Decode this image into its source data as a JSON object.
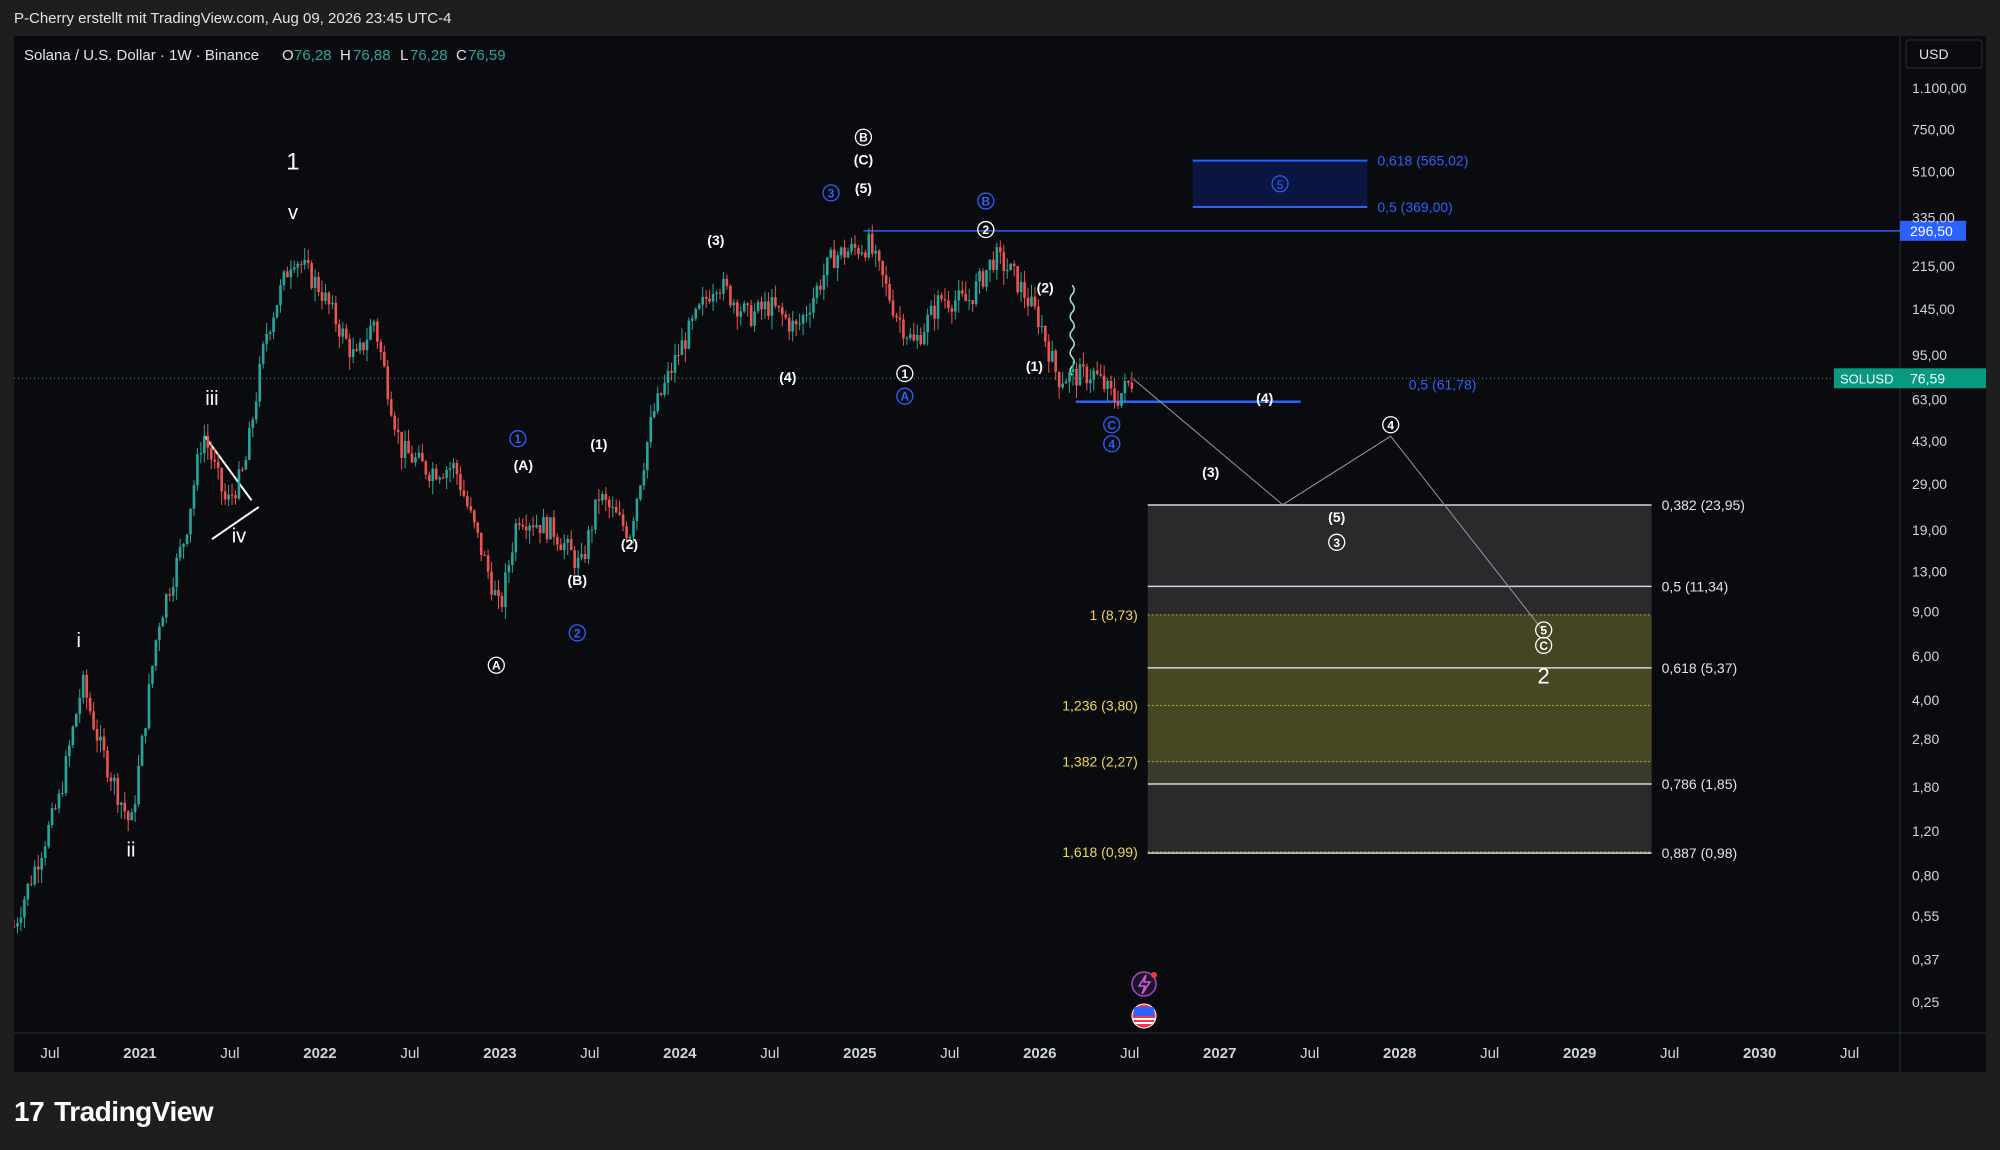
{
  "attribution": "P-Cherry erstellt mit TradingView.com, Aug 09, 2026 23:45 UTC-4",
  "brand": {
    "name": "TradingView",
    "logo_glyph": "17"
  },
  "chart_data": {
    "type": "candlestick",
    "symbol_line": "Solana / U.S. Dollar · 1W · Binance",
    "ohlc": {
      "O_label": "O",
      "O": "76,28",
      "H_label": "H",
      "H": "76,88",
      "L_label": "L",
      "L": "76,28",
      "C_label": "C",
      "C": "76,59"
    },
    "currency": "USD",
    "y_scale": "log",
    "y_ticks": [
      "1.100,00",
      "750,00",
      "510,00",
      "335,00",
      "215,00",
      "145,00",
      "95,00",
      "63,00",
      "43,00",
      "29,00",
      "19,00",
      "13,00",
      "9,00",
      "6,00",
      "4,00",
      "2,80",
      "1,80",
      "1,20",
      "0,80",
      "0,55",
      "0,37",
      "0,25"
    ],
    "y_tick_values": [
      1100,
      750,
      510,
      335,
      215,
      145,
      95,
      63,
      43,
      29,
      19,
      13,
      9,
      6,
      4,
      2.8,
      1.8,
      1.2,
      0.8,
      0.55,
      0.37,
      0.25
    ],
    "x_ticks": [
      {
        "label": "Jul",
        "t": 2020.5,
        "bold": false
      },
      {
        "label": "2021",
        "t": 2021.0,
        "bold": true
      },
      {
        "label": "Jul",
        "t": 2021.5,
        "bold": false
      },
      {
        "label": "2022",
        "t": 2022.0,
        "bold": true
      },
      {
        "label": "Jul",
        "t": 2022.5,
        "bold": false
      },
      {
        "label": "2023",
        "t": 2023.0,
        "bold": true
      },
      {
        "label": "Jul",
        "t": 2023.5,
        "bold": false
      },
      {
        "label": "2024",
        "t": 2024.0,
        "bold": true
      },
      {
        "label": "Jul",
        "t": 2024.5,
        "bold": false
      },
      {
        "label": "2025",
        "t": 2025.0,
        "bold": true
      },
      {
        "label": "Jul",
        "t": 2025.5,
        "bold": false
      },
      {
        "label": "2026",
        "t": 2026.0,
        "bold": true
      },
      {
        "label": "Jul",
        "t": 2026.5,
        "bold": false
      },
      {
        "label": "2027",
        "t": 2027.0,
        "bold": true
      },
      {
        "label": "Jul",
        "t": 2027.5,
        "bold": false
      },
      {
        "label": "2028",
        "t": 2028.0,
        "bold": true
      },
      {
        "label": "Jul",
        "t": 2028.5,
        "bold": false
      },
      {
        "label": "2029",
        "t": 2029.0,
        "bold": true
      },
      {
        "label": "Jul",
        "t": 2029.5,
        "bold": false
      },
      {
        "label": "2030",
        "t": 2030.0,
        "bold": true
      },
      {
        "label": "Jul",
        "t": 2030.5,
        "bold": false
      }
    ],
    "price_path": [
      {
        "t": 2020.3,
        "p": 0.5
      },
      {
        "t": 2020.55,
        "p": 1.6
      },
      {
        "t": 2020.68,
        "p": 4.7
      },
      {
        "t": 2020.78,
        "p": 2.6
      },
      {
        "t": 2020.95,
        "p": 1.25
      },
      {
        "t": 2021.1,
        "p": 8.0
      },
      {
        "t": 2021.25,
        "p": 18
      },
      {
        "t": 2021.35,
        "p": 47
      },
      {
        "t": 2021.48,
        "p": 24
      },
      {
        "t": 2021.58,
        "p": 33
      },
      {
        "t": 2021.7,
        "p": 115
      },
      {
        "t": 2021.85,
        "p": 240
      },
      {
        "t": 2022.0,
        "p": 175
      },
      {
        "t": 2022.2,
        "p": 90
      },
      {
        "t": 2022.3,
        "p": 130
      },
      {
        "t": 2022.45,
        "p": 40
      },
      {
        "t": 2022.6,
        "p": 33
      },
      {
        "t": 2022.75,
        "p": 34
      },
      {
        "t": 2022.95,
        "p": 12
      },
      {
        "t": 2023.0,
        "p": 9
      },
      {
        "t": 2023.1,
        "p": 22
      },
      {
        "t": 2023.3,
        "p": 19
      },
      {
        "t": 2023.45,
        "p": 13.5
      },
      {
        "t": 2023.55,
        "p": 26
      },
      {
        "t": 2023.72,
        "p": 18.5
      },
      {
        "t": 2023.85,
        "p": 55
      },
      {
        "t": 2024.0,
        "p": 100
      },
      {
        "t": 2024.2,
        "p": 190
      },
      {
        "t": 2024.38,
        "p": 135
      },
      {
        "t": 2024.5,
        "p": 150
      },
      {
        "t": 2024.65,
        "p": 120
      },
      {
        "t": 2024.85,
        "p": 235
      },
      {
        "t": 2025.05,
        "p": 262
      },
      {
        "t": 2025.2,
        "p": 140
      },
      {
        "t": 2025.3,
        "p": 105
      },
      {
        "t": 2025.45,
        "p": 160
      },
      {
        "t": 2025.6,
        "p": 155
      },
      {
        "t": 2025.75,
        "p": 235
      },
      {
        "t": 2025.85,
        "p": 200
      },
      {
        "t": 2026.0,
        "p": 130
      },
      {
        "t": 2026.1,
        "p": 77
      },
      {
        "t": 2026.3,
        "p": 80
      },
      {
        "t": 2026.42,
        "p": 63
      },
      {
        "t": 2026.52,
        "p": 76
      }
    ],
    "last_price": {
      "label": "76,59",
      "value": 76.59,
      "symbol": "SOLUSD"
    },
    "resistance": {
      "label": "296,50",
      "value": 296.5,
      "t_start": 2025.02,
      "t_end": 2031.0
    },
    "support": {
      "value": 61.78,
      "t_start": 2026.2,
      "t_end": 2027.45
    },
    "support_label": "0,5 (61,78)",
    "target_box": {
      "t_start": 2026.85,
      "t_end": 2027.82,
      "top": 565.02,
      "bottom": 369.0,
      "wave": "5",
      "labels": [
        {
          "text": "0,618 (565,02)",
          "value": 565.02
        },
        {
          "text": "0,5 (369,00)",
          "value": 369.0
        }
      ]
    },
    "retracement": {
      "t_start": 2026.6,
      "t_end": 2029.4,
      "levels": [
        {
          "text": "0,382 (23,95)",
          "value": 23.95,
          "side": "right"
        },
        {
          "text": "0,5 (11,34)",
          "value": 11.34,
          "side": "right"
        },
        {
          "text": "0,618 (5,37)",
          "value": 5.37,
          "side": "right"
        },
        {
          "text": "0,786 (1,85)",
          "value": 1.85,
          "side": "right"
        },
        {
          "text": "0,887 (0,98)",
          "value": 0.98,
          "side": "right"
        }
      ],
      "extensions": [
        {
          "text": "1 (8,73)",
          "value": 8.73
        },
        {
          "text": "1,236 (3,80)",
          "value": 3.8
        },
        {
          "text": "1,382 (2,27)",
          "value": 2.27
        },
        {
          "text": "1,618 (0,99)",
          "value": 0.99
        }
      ]
    },
    "projection": [
      {
        "t": 2026.52,
        "p": 76
      },
      {
        "t": 2027.35,
        "p": 24
      },
      {
        "t": 2027.95,
        "p": 45
      },
      {
        "t": 2028.8,
        "p": 7.5
      }
    ],
    "wave_labels": [
      {
        "text": "1",
        "t": 2021.85,
        "p": 520,
        "style": "big"
      },
      {
        "text": "v",
        "t": 2021.85,
        "p": 330,
        "style": "roman"
      },
      {
        "text": "iii",
        "t": 2021.4,
        "p": 60,
        "style": "roman"
      },
      {
        "text": "iv",
        "t": 2021.55,
        "p": 17,
        "style": "roman"
      },
      {
        "text": "i",
        "t": 2020.66,
        "p": 6.5,
        "style": "roman"
      },
      {
        "text": "ii",
        "t": 2020.95,
        "p": 0.95,
        "style": "roman"
      },
      {
        "text": "(3)",
        "t": 2024.2,
        "p": 260,
        "style": "paren"
      },
      {
        "text": "(4)",
        "t": 2024.6,
        "p": 74,
        "style": "paren"
      },
      {
        "text": "(A)",
        "t": 2023.13,
        "p": 33,
        "style": "paren"
      },
      {
        "text": "(B)",
        "t": 2023.43,
        "p": 11.5,
        "style": "paren"
      },
      {
        "text": "(1)",
        "t": 2023.55,
        "p": 40,
        "style": "paren"
      },
      {
        "text": "(2)",
        "t": 2023.72,
        "p": 16,
        "style": "paren"
      },
      {
        "text": "(C)",
        "t": 2025.02,
        "p": 545,
        "style": "paren"
      },
      {
        "text": "(5)",
        "t": 2025.02,
        "p": 420,
        "style": "paren"
      },
      {
        "text": "(2)",
        "t": 2026.03,
        "p": 168,
        "style": "paren"
      },
      {
        "text": "(1)",
        "t": 2025.97,
        "p": 82,
        "style": "paren"
      },
      {
        "text": "(4)",
        "t": 2027.25,
        "p": 61,
        "style": "paren"
      },
      {
        "text": "(3)",
        "t": 2026.95,
        "p": 31,
        "style": "paren"
      },
      {
        "text": "(5)",
        "t": 2027.65,
        "p": 20.5,
        "style": "paren"
      }
    ],
    "circle_labels": [
      {
        "text": "B",
        "t": 2025.02,
        "p": 700,
        "color": "white"
      },
      {
        "text": "3",
        "t": 2024.84,
        "p": 420,
        "color": "blue"
      },
      {
        "text": "B",
        "t": 2025.7,
        "p": 390,
        "color": "blue"
      },
      {
        "text": "2",
        "t": 2025.7,
        "p": 300,
        "color": "white"
      },
      {
        "text": "1",
        "t": 2025.25,
        "p": 80,
        "color": "white"
      },
      {
        "text": "A",
        "t": 2025.25,
        "p": 65,
        "color": "blue"
      },
      {
        "text": "C",
        "t": 2026.4,
        "p": 50,
        "color": "blue"
      },
      {
        "text": "4",
        "t": 2026.4,
        "p": 42,
        "color": "blue"
      },
      {
        "text": "1",
        "t": 2023.1,
        "p": 44,
        "color": "blue"
      },
      {
        "text": "2",
        "t": 2023.43,
        "p": 7.4,
        "color": "blue"
      },
      {
        "text": "A",
        "t": 2022.98,
        "p": 5.5,
        "color": "white"
      },
      {
        "text": "3",
        "t": 2027.65,
        "p": 17.0,
        "color": "white"
      },
      {
        "text": "4",
        "t": 2027.95,
        "p": 50,
        "color": "white"
      },
      {
        "text": "5",
        "t": 2028.8,
        "p": 7.6,
        "color": "white"
      },
      {
        "text": "C",
        "t": 2028.8,
        "p": 6.6,
        "color": "white"
      }
    ],
    "target_label": {
      "text": "2",
      "t": 2028.8,
      "p": 4.65
    }
  }
}
